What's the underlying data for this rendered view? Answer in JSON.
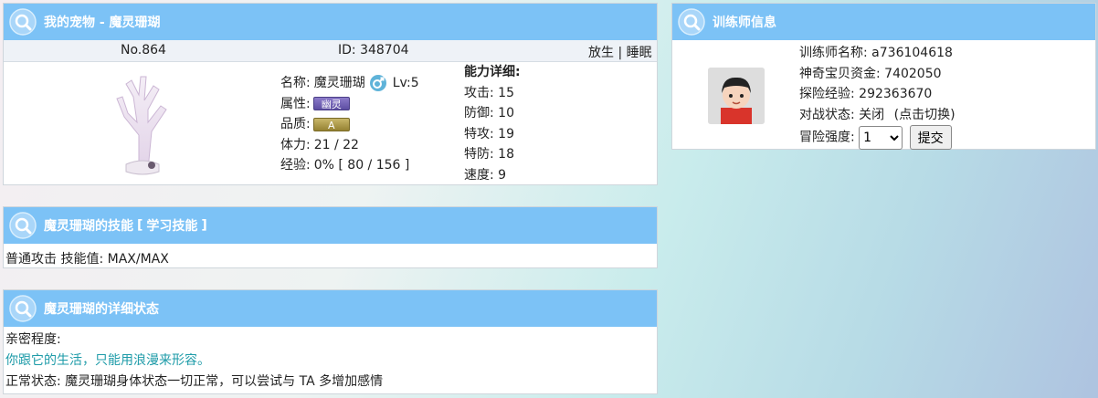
{
  "pet_panel": {
    "title": "我的宠物 - 魔灵珊瑚",
    "number": "No.864",
    "id": "ID: 348704",
    "actions": {
      "release": "放生",
      "sep": "|",
      "sleep": "睡眠"
    },
    "name_label": "名称:",
    "name_value": "魔灵珊瑚",
    "level": "Lv:5",
    "attr_label": "属性:",
    "attr_badge": "幽灵",
    "quality_label": "品质:",
    "quality_badge": "A",
    "hp_label": "体力:",
    "hp_value": "21 / 22",
    "exp_label": "经验:",
    "exp_value": "0% [ 80 / 156 ]",
    "abilities_title": "能力详细:",
    "abilities": [
      {
        "label": "攻击:",
        "value": "15"
      },
      {
        "label": "防御:",
        "value": "10"
      },
      {
        "label": "特攻:",
        "value": "19"
      },
      {
        "label": "特防:",
        "value": "18"
      },
      {
        "label": "速度:",
        "value": "9"
      }
    ],
    "colors": {
      "attr_badge": "#6e5db5",
      "quality_badge": "#a8953f"
    }
  },
  "trainer_panel": {
    "title": "训练师信息",
    "name_label": "训练师名称:",
    "name_value": "a736104618",
    "funds_label": "神奇宝贝资金:",
    "funds_value": "7402050",
    "exp_label": "探险经验:",
    "exp_value": "292363670",
    "battle_label": "对战状态:",
    "battle_value": "关闭",
    "battle_hint": "(点击切换)",
    "intensity_label": "冒险强度:",
    "intensity_selected": "1",
    "submit_label": "提交"
  },
  "skill_panel": {
    "title": "魔灵珊瑚的技能",
    "bracket_open": "[",
    "learn_link": "学习技能",
    "bracket_close": "]",
    "skill_text": "普通攻击 技能值: MAX/MAX"
  },
  "status_panel": {
    "title": "魔灵珊瑚的详细状态",
    "intimacy_label": "亲密程度:",
    "intimacy_text": "你跟它的生活，只能用浪漫来形容。",
    "normal_status": "正常状态: 魔灵珊瑚身体状态一切正常，可以尝试与 TA 多增加感情"
  },
  "colors": {
    "header_bg": "#7cc2f6",
    "teal_text": "#1d9ba8"
  },
  "icons": [
    "search-icon",
    "gender-icon",
    "avatar"
  ]
}
